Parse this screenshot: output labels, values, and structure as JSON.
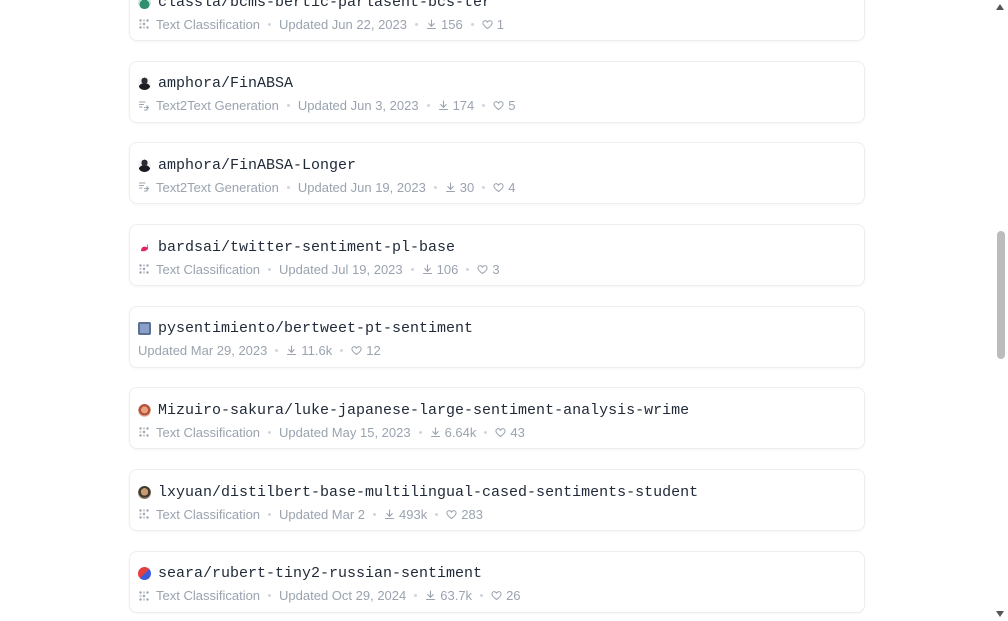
{
  "models": [
    {
      "name": "classla/bcms-bertic-parlasent-bcs-ter",
      "avatar": "avatar-classla",
      "task": "Text Classification",
      "task_icon": "text-classification-icon",
      "updated": "Updated Jun 22, 2023",
      "downloads": "156",
      "likes": "1"
    },
    {
      "name": "amphora/FinABSA",
      "avatar": "avatar-amphora",
      "task": "Text2Text Generation",
      "task_icon": "text2text-generation-icon",
      "updated": "Updated Jun 3, 2023",
      "downloads": "174",
      "likes": "5"
    },
    {
      "name": "amphora/FinABSA-Longer",
      "avatar": "avatar-amphora",
      "task": "Text2Text Generation",
      "task_icon": "text2text-generation-icon",
      "updated": "Updated Jun 19, 2023",
      "downloads": "30",
      "likes": "4"
    },
    {
      "name": "bardsai/twitter-sentiment-pl-base",
      "avatar": "avatar-bardsai",
      "task": "Text Classification",
      "task_icon": "text-classification-icon",
      "updated": "Updated Jul 19, 2023",
      "downloads": "106",
      "likes": "3"
    },
    {
      "name": "pysentimiento/bertweet-pt-sentiment",
      "avatar": "avatar-pysentimiento",
      "task": "",
      "task_icon": "",
      "updated": "Updated Mar 29, 2023",
      "downloads": "11.6k",
      "likes": "12"
    },
    {
      "name": "Mizuiro-sakura/luke-japanese-large-sentiment-analysis-wrime",
      "avatar": "avatar-mizuiro",
      "task": "Text Classification",
      "task_icon": "text-classification-icon",
      "updated": "Updated May 15, 2023",
      "downloads": "6.64k",
      "likes": "43"
    },
    {
      "name": "lxyuan/distilbert-base-multilingual-cased-sentiments-student",
      "avatar": "avatar-lxyuan",
      "task": "Text Classification",
      "task_icon": "text-classification-icon",
      "updated": "Updated Mar 2",
      "downloads": "493k",
      "likes": "283"
    },
    {
      "name": "seara/rubert-tiny2-russian-sentiment",
      "avatar": "avatar-seara",
      "task": "Text Classification",
      "task_icon": "text-classification-icon",
      "updated": "Updated Oct 29, 2024",
      "downloads": "63.7k",
      "likes": "26"
    }
  ],
  "colors": {
    "title": "#1f2937",
    "meta": "#9aa3af",
    "card_border": "#eceef1",
    "scroll_thumb": "#bcbcbc"
  }
}
